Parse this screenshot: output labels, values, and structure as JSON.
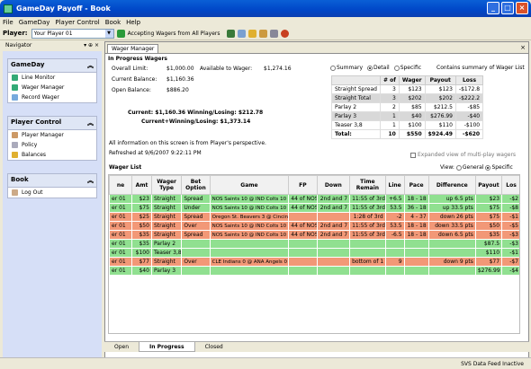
{
  "window": {
    "title": "GameDay Payoff - Book"
  },
  "menu": [
    "File",
    "GameDay",
    "Player Control",
    "Book",
    "Help"
  ],
  "toolbar": {
    "player_label": "Player:",
    "player_value": "Your Player 01",
    "accept_label": "Accepting Wagers from All Players"
  },
  "navigator": {
    "title": "Navigator",
    "groups": [
      {
        "title": "GameDay",
        "items": [
          "Line Monitor",
          "Wager Manager",
          "Record Wager"
        ]
      },
      {
        "title": "Player Control",
        "items": [
          "Player Manager",
          "Policy",
          "Balances"
        ]
      },
      {
        "title": "Book",
        "items": [
          "Log Out"
        ]
      }
    ]
  },
  "wager_manager": {
    "tab": "Wager Manager",
    "section": "In Progress Wagers",
    "overall_limit_label": "Overall Limit:",
    "overall_limit": "$1,000.00",
    "current_balance_label": "Current Balance:",
    "current_balance": "$1,160.36",
    "open_balance_label": "Open Balance:",
    "open_balance": "$886.20",
    "available_label": "Available to Wager:",
    "available": "$1,274.16",
    "current_line": "Current: $1,160.36    Winning/Losing: $212.78",
    "current_plus_line": "Current+Winning/Losing: $1,373.14",
    "perspective": "All information on this screen is from Player's perspective.",
    "refreshed": "Refreshed at 9/6/2007 9:22:11 PM",
    "radios": [
      "Summary",
      "Detail",
      "Specific"
    ],
    "contains": "Contains summary of Wager List",
    "expanded": "Expanded view of multi-play wagers"
  },
  "summary_table": {
    "headers": [
      "",
      "# of",
      "Wager",
      "Payout",
      "Loss"
    ],
    "rows": [
      [
        "Straight Spread",
        "3",
        "$123",
        "$123",
        "-$172.8"
      ],
      [
        "Straight Total",
        "3",
        "$202",
        "$202",
        "-$222.2"
      ],
      [
        "Parlay 2",
        "2",
        "$85",
        "$212.5",
        "-$85"
      ],
      [
        "Parlay 3",
        "1",
        "$40",
        "$276.99",
        "-$40"
      ],
      [
        "Teaser 3,8",
        "1",
        "$100",
        "$110",
        "-$100"
      ]
    ],
    "total": [
      "Total:",
      "10",
      "$550",
      "$924.49",
      "-$620"
    ]
  },
  "wager_list": {
    "title": "Wager List",
    "view_label": "View:",
    "views": [
      "General",
      "Specific"
    ],
    "headers": [
      "ne",
      "Amt",
      "Wager Type",
      "Bet Option",
      "Game",
      "FP",
      "Down",
      "Time Remain",
      "Line",
      "Pace",
      "Difference",
      "Payout",
      "Los"
    ],
    "rows": [
      {
        "c": "g",
        "v": [
          "er 01",
          "$23",
          "Straight",
          "Spread",
          "NOS Saints 10 @ IND Colts 10",
          "44 of NOS",
          "2nd and 7",
          "11:55 of 3rd",
          "+6.5",
          "18 - 18",
          "up 6.5 pts",
          "$23",
          "-$2"
        ]
      },
      {
        "c": "g",
        "v": [
          "er 01",
          "$75",
          "Straight",
          "Under",
          "NOS Saints 10 @ IND Colts 10",
          "44 of NOS",
          "2nd and 7",
          "11:55 of 3rd",
          "53.5",
          "36 - 18",
          "up 33.5 pts",
          "$75",
          "-$8"
        ]
      },
      {
        "c": "o",
        "v": [
          "er 01",
          "$25",
          "Straight",
          "Spread",
          "Oregon St. Beavers 3 @ Cincinnati Bearcats 27",
          "",
          "",
          "1:28 of 3rd",
          "-2",
          "4 - 37",
          "down 26 pts",
          "$75",
          "-$1"
        ]
      },
      {
        "c": "o",
        "v": [
          "er 01",
          "$50",
          "Straight",
          "Over",
          "NOS Saints 10 @ IND Colts 10",
          "44 of NOS",
          "2nd and 7",
          "11:55 of 3rd",
          "53.5",
          "18 - 18",
          "down 33.5 pts",
          "$50",
          "-$5"
        ]
      },
      {
        "c": "o",
        "v": [
          "er 01",
          "$35",
          "Straight",
          "Spread",
          "NOS Saints 10 @ IND Colts 10",
          "44 of NOS",
          "2nd and 7",
          "11:55 of 3rd",
          "-6.5",
          "18 - 18",
          "down 6.5 pts",
          "$35",
          "-$3"
        ]
      },
      {
        "c": "g",
        "v": [
          "er 01",
          "$35",
          "Parlay 2",
          "",
          "",
          "",
          "",
          "",
          "",
          "",
          "",
          "$87.5",
          "-$3"
        ]
      },
      {
        "c": "g",
        "v": [
          "er 01",
          "$100",
          "Teaser 3,8",
          "",
          "",
          "",
          "",
          "",
          "",
          "",
          "",
          "$110",
          "-$1"
        ]
      },
      {
        "c": "o",
        "v": [
          "er 01",
          "$77",
          "Straight",
          "Over",
          "CLE Indians 0 @ ANA Angels 0",
          "",
          "",
          "bottom of 1",
          "9",
          "",
          "down 9 pts",
          "$77",
          "-$7"
        ]
      },
      {
        "c": "g",
        "v": [
          "er 01",
          "$40",
          "Parlay 3",
          "",
          "",
          "",
          "",
          "",
          "",
          "",
          "",
          "$276.99",
          "-$4"
        ]
      }
    ]
  },
  "bottom_tabs": [
    "Open",
    "In Progress",
    "Closed"
  ],
  "status": "SVS Data Feed Inactive"
}
